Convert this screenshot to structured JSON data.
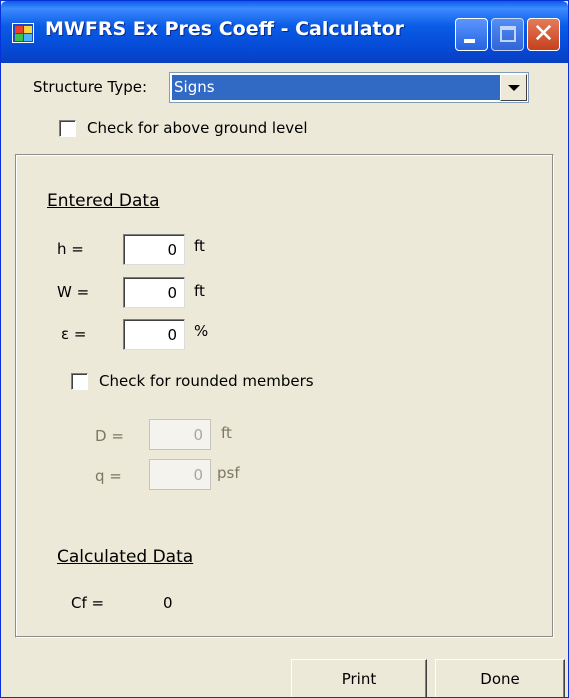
{
  "window": {
    "title": "MWFRS Ex Pres Coeff - Calculator"
  },
  "titlebar_buttons": {
    "minimize_icon": "minimize-icon",
    "maximize_icon": "maximize-icon",
    "close_icon": "close-icon",
    "close_glyph": "✕"
  },
  "structure": {
    "label": "Structure Type:",
    "selected": "Signs",
    "dropdown_icon": "chevron-down-icon"
  },
  "above_ground": {
    "label": "Check for above ground level",
    "checked": false
  },
  "entered": {
    "header": "Entered Data",
    "rows": [
      {
        "label": "h  =",
        "value": "0",
        "unit": "ft"
      },
      {
        "label": "W  =",
        "value": "0",
        "unit": "ft"
      },
      {
        "label": "ε  =",
        "value": "0",
        "unit": "%"
      }
    ]
  },
  "rounded": {
    "label": "Check for rounded members",
    "checked": false
  },
  "rounded_fields": [
    {
      "label": "D  =",
      "value": "0",
      "unit": "ft"
    },
    {
      "label": "q  =",
      "value": "0",
      "unit": "psf"
    }
  ],
  "calculated": {
    "header": "Calculated Data",
    "cf_label": "Cf  =",
    "cf_value": "0"
  },
  "buttons": {
    "print": "Print",
    "done": "Done"
  },
  "colors": {
    "title_bar": "#0a5ce6",
    "selection": "#316ac5",
    "face": "#ece9d8"
  }
}
